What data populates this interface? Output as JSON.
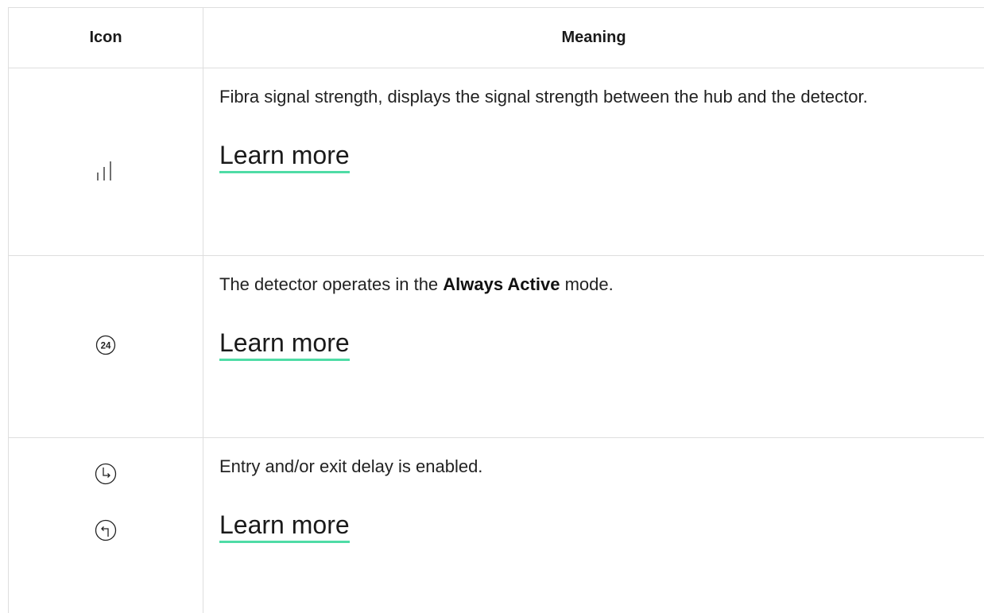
{
  "header": {
    "icon_col": "Icon",
    "meaning_col": "Meaning"
  },
  "rows": [
    {
      "icons": [
        "signal-strength-icon"
      ],
      "description": "Fibra signal strength, displays the signal strength between the hub and the detector.",
      "link": "Learn more"
    },
    {
      "icons": [
        "always-active-24-icon"
      ],
      "icon_text": "24",
      "description_prefix": "The detector operates in the ",
      "description_bold": "Always Active",
      "description_suffix": " mode.",
      "link": "Learn more"
    },
    {
      "icons": [
        "entry-delay-icon",
        "exit-delay-icon"
      ],
      "description": "Entry and/or exit delay is enabled.",
      "link": "Learn more"
    }
  ],
  "colors": {
    "link_underline": "#4fdca6",
    "border": "#dedede",
    "text": "#222222"
  }
}
